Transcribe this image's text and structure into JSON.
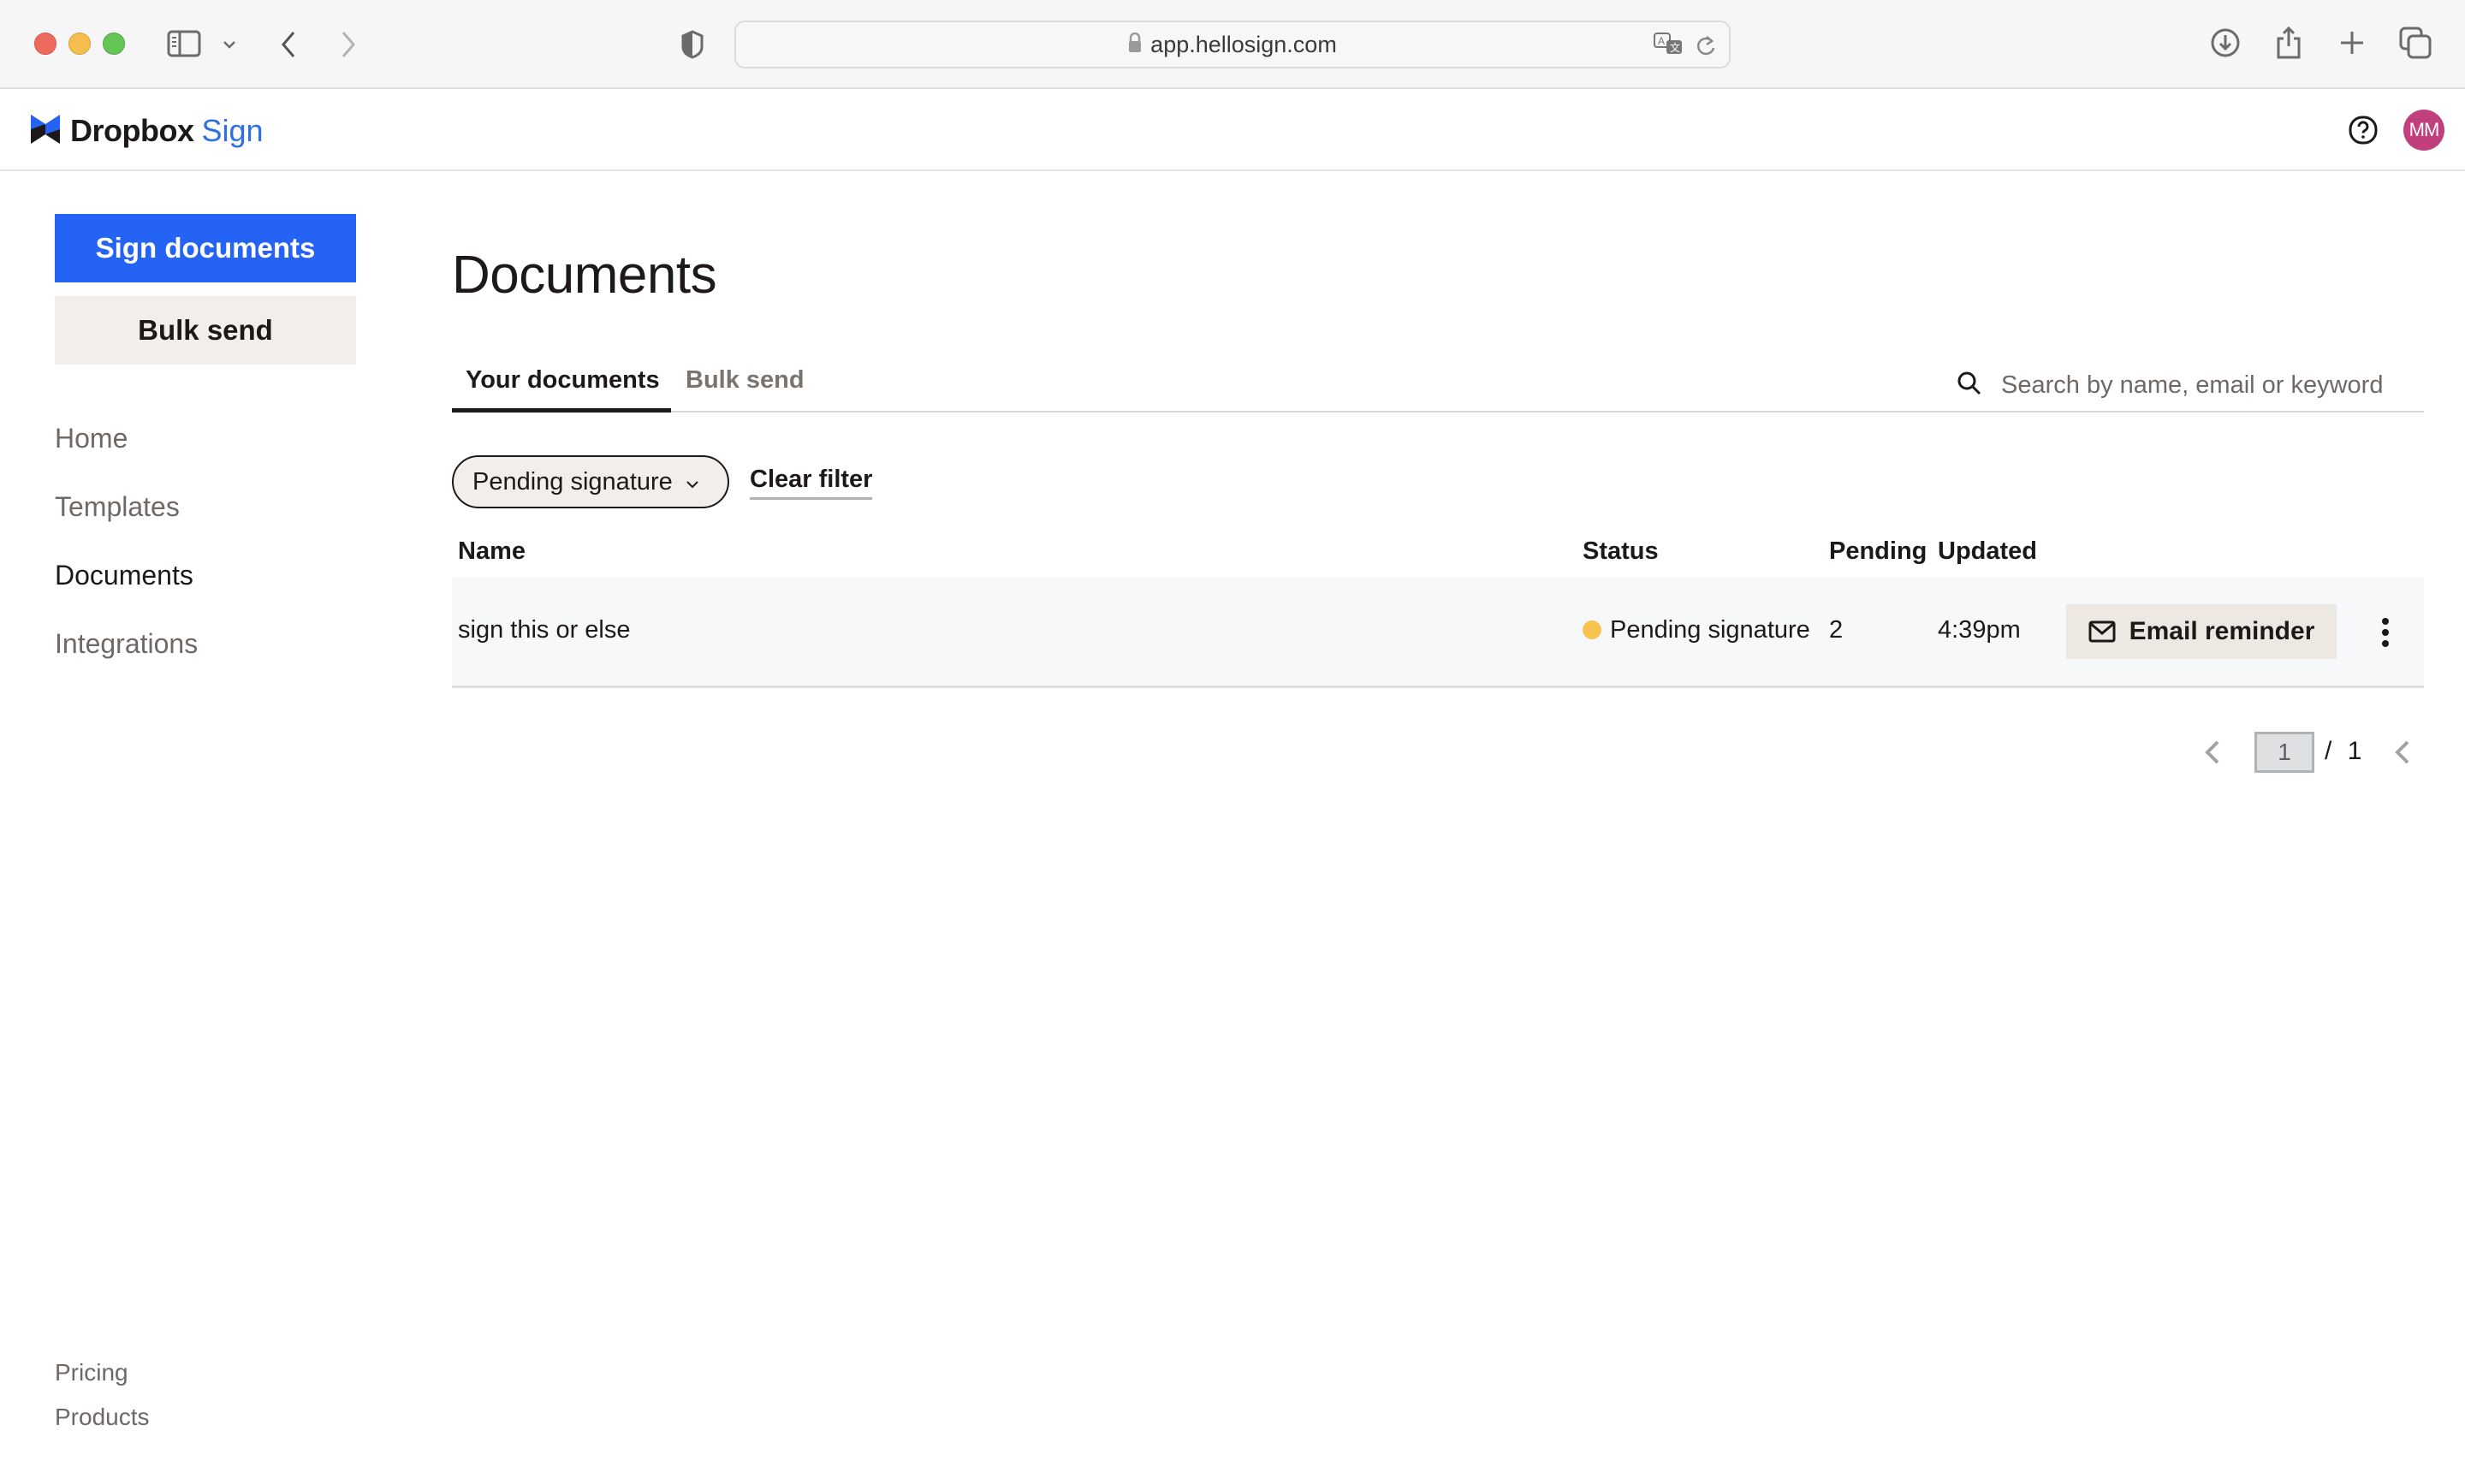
{
  "browser": {
    "url": "app.hellosign.com",
    "icons": [
      "sidebar-toggle-icon",
      "chevron-down-icon",
      "back-icon",
      "forward-icon",
      "shield-icon",
      "lock-icon",
      "translate-icon",
      "reload-icon",
      "download-icon",
      "share-icon",
      "new-tab-icon",
      "tab-overview-icon"
    ]
  },
  "header": {
    "logo_primary": "Dropbox",
    "logo_secondary": "Sign",
    "avatar_initials": "MM",
    "colors": {
      "brand_blue": "#2563f4",
      "avatar": "#c13f7d"
    }
  },
  "sidebar": {
    "primary_button": "Sign documents",
    "secondary_button": "Bulk send",
    "nav": [
      {
        "label": "Home",
        "active": false
      },
      {
        "label": "Templates",
        "active": false
      },
      {
        "label": "Documents",
        "active": true
      },
      {
        "label": "Integrations",
        "active": false
      }
    ],
    "footer": [
      {
        "label": "Pricing"
      },
      {
        "label": "Products"
      }
    ]
  },
  "main": {
    "title": "Documents",
    "tabs": [
      {
        "label": "Your documents",
        "active": true
      },
      {
        "label": "Bulk send",
        "active": false
      }
    ],
    "search": {
      "placeholder": "Search by name, email or keyword",
      "value": ""
    },
    "filter": {
      "selected": "Pending signature",
      "clear_label": "Clear filter"
    },
    "table": {
      "columns": [
        "Name",
        "Status",
        "Pending",
        "Updated"
      ],
      "rows": [
        {
          "name": "sign this or else",
          "status": "Pending signature",
          "status_color": "#f7c44f",
          "pending": "2",
          "updated": "4:39pm",
          "action": "Email reminder"
        }
      ]
    },
    "pagination": {
      "current": "1",
      "separator": "/",
      "total": "1"
    }
  }
}
